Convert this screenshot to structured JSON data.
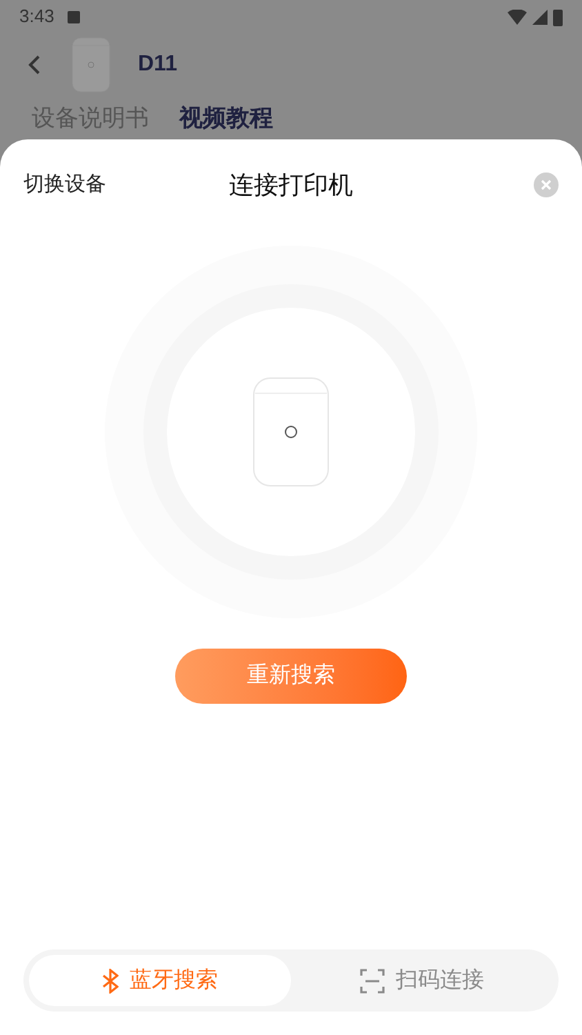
{
  "status_bar": {
    "time": "3:43"
  },
  "header": {
    "title": "D11"
  },
  "page_tabs": [
    {
      "label": "设备说明书",
      "selected": false
    },
    {
      "label": "视频教程",
      "selected": true
    }
  ],
  "sheet": {
    "switch_label": "切换设备",
    "title": "连接打印机",
    "button": "重新搜索",
    "modes": [
      {
        "kind": "bluetooth",
        "label": "蓝牙搜索",
        "selected": true
      },
      {
        "kind": "scan",
        "label": "扫码连接",
        "selected": false
      }
    ]
  }
}
